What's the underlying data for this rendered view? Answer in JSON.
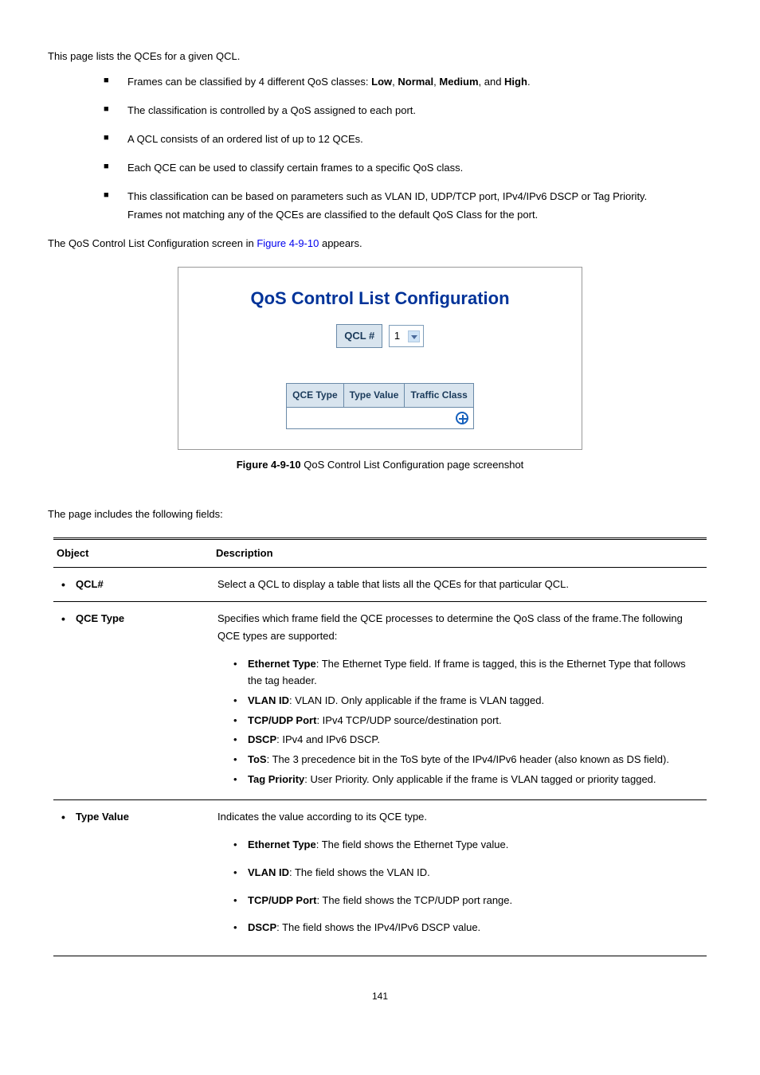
{
  "intro": "This page lists the QCEs for a given QCL.",
  "bullets": {
    "b1_pre": "Frames can be classified by 4 different QoS classes: ",
    "b1_c1": "Low",
    "b1_s1": ", ",
    "b1_c2": "Normal",
    "b1_s2": ", ",
    "b1_c3": "Medium",
    "b1_s3": ", and ",
    "b1_c4": "High",
    "b1_s4": ".",
    "b2": "The classification is controlled by a QoS assigned to each port.",
    "b3": "A QCL consists of an ordered list of up to 12 QCEs.",
    "b4": "Each QCE can be used to classify certain frames to a specific QoS class.",
    "b5a": "This classification can be based on parameters such as VLAN ID, UDP/TCP port, IPv4/IPv6 DSCP or Tag Priority.",
    "b5b": "Frames not matching any of the QCEs are classified to the default QoS Class for the port."
  },
  "pre_fig_a": "The QoS Control List Configuration screen in ",
  "pre_fig_link": "Figure 4-9-10",
  "pre_fig_b": " appears.",
  "figure": {
    "title": "QoS Control List Configuration",
    "qcl_label": "QCL #",
    "qcl_value": "1",
    "th1": "QCE Type",
    "th2": "Type Value",
    "th3": "Traffic Class"
  },
  "caption_pre": "Figure 4-9-10 ",
  "caption_txt": "QoS Control List Configuration page screenshot",
  "fields_intro": "The page includes the following fields:",
  "table": {
    "h1": "Object",
    "h2": "Description",
    "r1_obj": "QCL#",
    "r1_desc": "Select a QCL to display a table that lists all the QCEs for that particular QCL.",
    "r2_obj": "QCE Type",
    "r2_p1": "Specifies which frame field the QCE processes to determine the QoS class of the frame.The following QCE types are supported:",
    "r2_li1_b": "Ethernet Type",
    "r2_li1_t": ": The Ethernet Type field. If frame is tagged, this is the Ethernet Type that follows the tag header.",
    "r2_li2_b": "VLAN ID",
    "r2_li2_t": ": VLAN ID. Only applicable if the frame is VLAN tagged.",
    "r2_li3_b": "TCP/UDP Port",
    "r2_li3_t": ": IPv4 TCP/UDP source/destination port.",
    "r2_li4_b": "DSCP",
    "r2_li4_t": ": IPv4 and IPv6 DSCP.",
    "r2_li5_b": "ToS",
    "r2_li5_t": ": The 3 precedence bit in the ToS byte of the IPv4/IPv6 header (also known as DS field).",
    "r2_li6_b": "Tag Priority",
    "r2_li6_t": ": User Priority. Only applicable if the frame is VLAN tagged or priority tagged.",
    "r3_obj": "Type Value",
    "r3_p1": "Indicates the value according to its QCE type.",
    "r3_li1_b": "Ethernet Type",
    "r3_li1_t": ": The field shows the Ethernet Type value.",
    "r3_li2_b": "VLAN ID",
    "r3_li2_t": ": The field shows the VLAN ID.",
    "r3_li3_b": "TCP/UDP Port",
    "r3_li3_t": ": The field shows the TCP/UDP port range.",
    "r3_li4_b": "DSCP",
    "r3_li4_t": ": The field shows the IPv4/IPv6 DSCP value."
  },
  "page_num": "141"
}
